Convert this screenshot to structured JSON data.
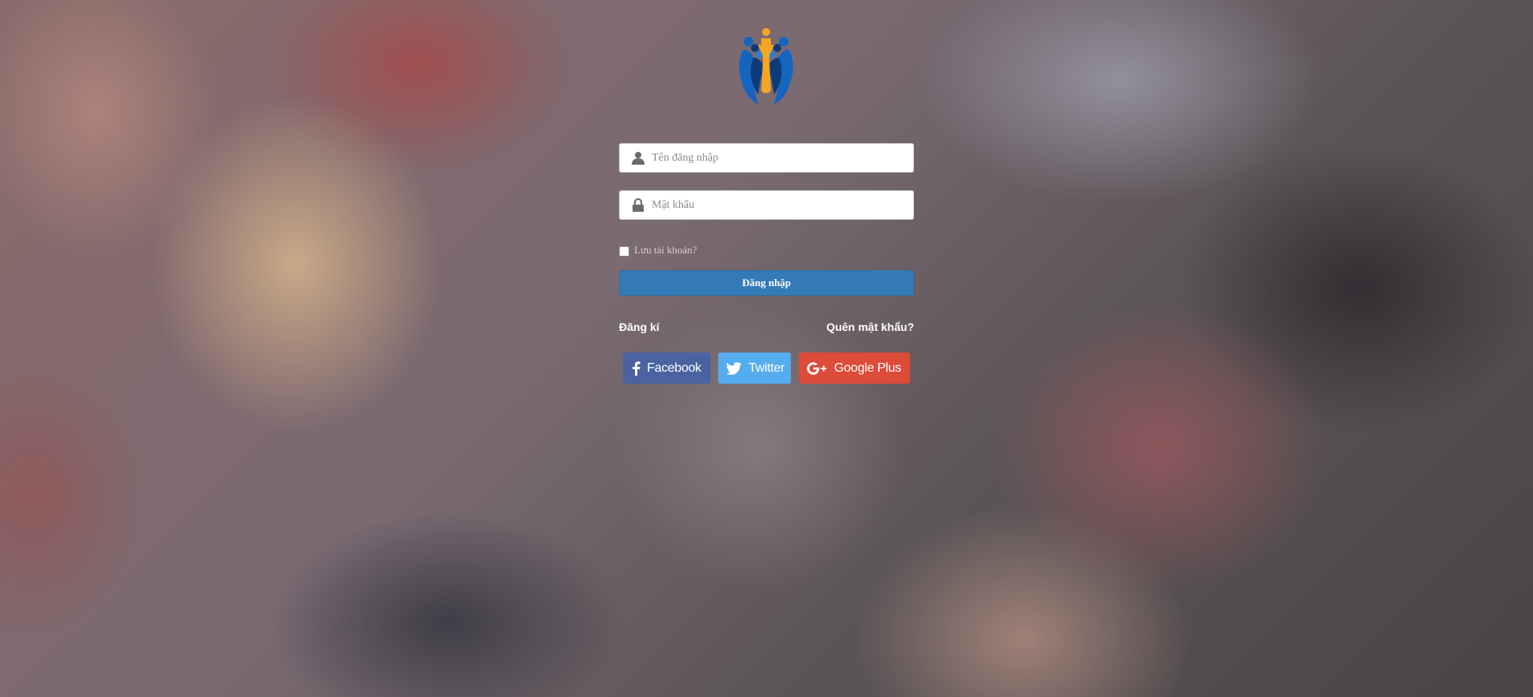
{
  "login_form": {
    "username_placeholder": "Tên đăng nhập",
    "password_placeholder": "Mật khẩu",
    "remember_label": "Lưu tài khoản?",
    "remember_checked": false,
    "submit_label": "Đăng nhập"
  },
  "links": {
    "register": "Đăng kí",
    "forgot_password": "Quên mật khẩu?"
  },
  "social": {
    "facebook": "Facebook",
    "twitter": "Twitter",
    "google": "Google Plus"
  },
  "colors": {
    "primary": "#337ab7",
    "facebook": "#4a63a0",
    "twitter": "#55acee",
    "google": "#dd4b39",
    "logo_blue": "#1a6fc4",
    "logo_orange": "#f5a623"
  },
  "icons": {
    "username": "user-icon",
    "password": "lock-icon",
    "facebook": "facebook-icon",
    "twitter": "twitter-icon",
    "google": "google-plus-icon"
  }
}
